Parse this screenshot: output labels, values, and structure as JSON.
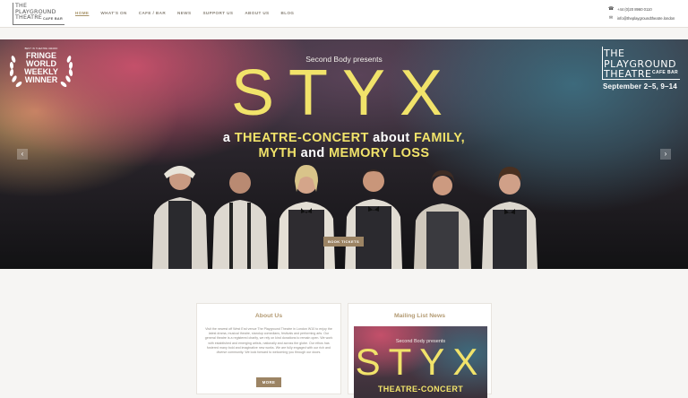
{
  "header": {
    "logo": {
      "line1": "THE",
      "line2": "PLAYGROUND",
      "line2b": "THEATRE",
      "line3": "CAFE BAR"
    },
    "nav": [
      {
        "label": "HOME",
        "active": true
      },
      {
        "label": "WHAT'S ON"
      },
      {
        "label": "CAFE / BAR"
      },
      {
        "label": "NEWS"
      },
      {
        "label": "SUPPORT US"
      },
      {
        "label": "ABOUT US"
      },
      {
        "label": "BLOG"
      }
    ],
    "contact": {
      "phone_icon": "phone-icon",
      "phone": "+44 (0)20 8960 0110",
      "email_icon": "envelope-icon",
      "email": "info@theplaygroundtheatre.london"
    }
  },
  "hero": {
    "award": {
      "small": "BEST IN THEATRE AWARD",
      "l1": "FRINGE",
      "l2": "WORLD",
      "l3": "WEEKLY",
      "l4": "WINNER"
    },
    "presents": "Second Body presents",
    "title": "STYX",
    "tagline1_a": "a ",
    "tagline1_b": "THEATRE-CONCERT",
    "tagline1_c": " about ",
    "tagline1_d": "FAMILY,",
    "tagline2_a": "MYTH",
    "tagline2_b": " and ",
    "tagline2_c": "MEMORY LOSS",
    "venue": {
      "l1": "THE",
      "l2": "PLAYGROUND",
      "l2b": "THEATRE",
      "l3": "CAFE BAR",
      "dates": "September 2–5, 9–14"
    },
    "prev_arrow": "‹",
    "next_arrow": "›",
    "book_button": "BOOK TICKETS"
  },
  "about": {
    "title": "About Us",
    "text": "Visit the newest off West End venue The Playground Theatre in London W10 to enjoy the latest drama, musical theatre, standup comedians, festivals and performing arts. Our general theatre is a registered charity, we rely on kind donations to remain open. We work with established and emerging artists, nationally and across the globe. Our ethos has fostered many bold and imaginative new works. We are fully engaged with our rich and diverse community. We look forward to welcoming you through our doors.",
    "more_button": "MORE"
  },
  "mailing": {
    "title": "Mailing List News",
    "poster_presents": "Second Body presents",
    "poster_title": "STYX",
    "poster_tag": "THEATRE-CONCERT"
  },
  "colors": {
    "accent": "#9c8464",
    "title_gold": "#b39a72",
    "styx_yellow": "#f1e36a"
  }
}
